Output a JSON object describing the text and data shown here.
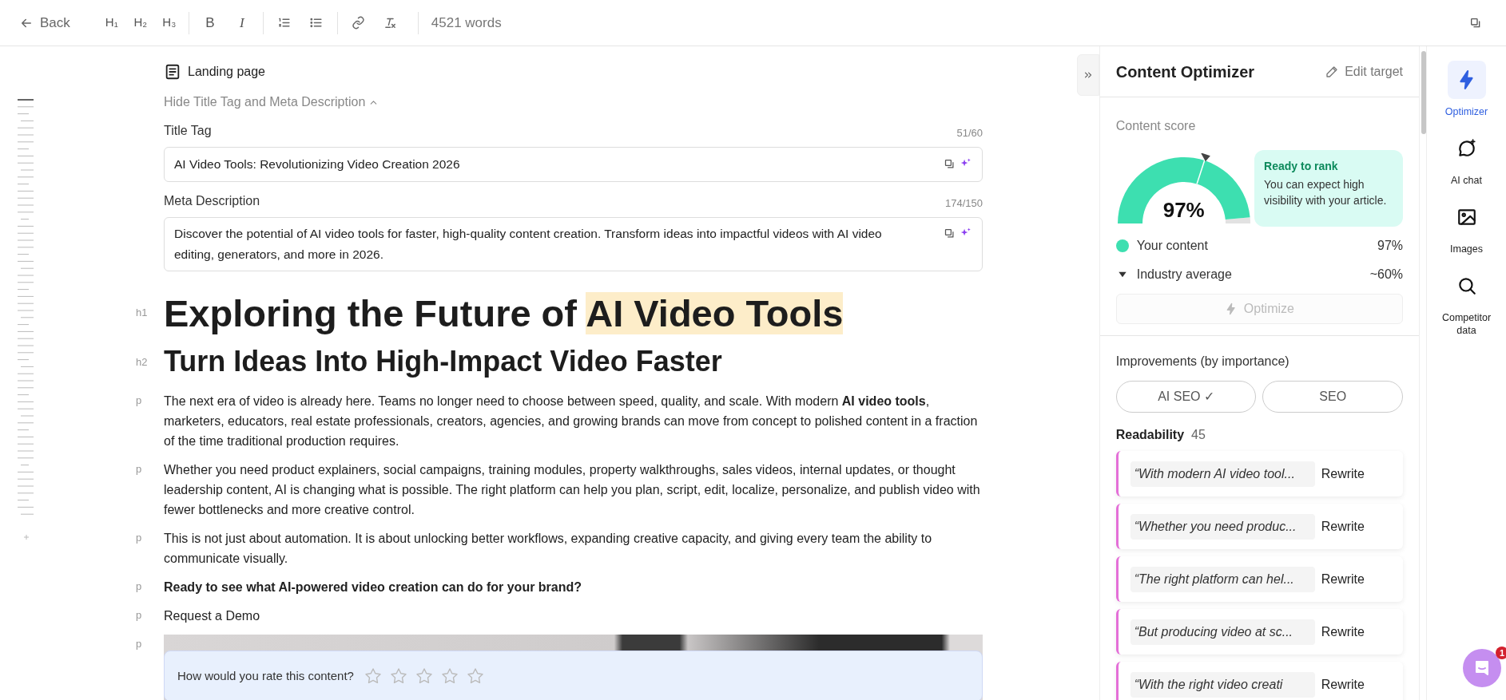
{
  "toolbar": {
    "back": "Back",
    "headings": [
      "H₁",
      "H₂",
      "H₃"
    ],
    "bold": "B",
    "italic": "I",
    "word_count": "4521 words"
  },
  "document": {
    "type_label": "Landing page",
    "toggle": "Hide Title Tag and Meta Description",
    "title_tag": {
      "label": "Title Tag",
      "count": "51/60",
      "value": "AI Video Tools: Revolutionizing Video Creation 2026"
    },
    "meta_description": {
      "label": "Meta Description",
      "count": "174/150",
      "value": "Discover the potential of AI video tools for faster, high-quality content creation. Transform ideas into impactful videos with AI video editing, generators, and more in 2026."
    },
    "blocks": [
      {
        "kind": "h1",
        "tag": "h1",
        "parts": [
          {
            "text": "Exploring the Future of ",
            "highlight": false
          },
          {
            "text": "AI Video Tools",
            "highlight": true
          }
        ]
      },
      {
        "kind": "h2",
        "tag": "h2",
        "parts": [
          {
            "text": "Turn Ideas Into High-Impact Video Faster",
            "highlight": false
          }
        ]
      },
      {
        "kind": "p",
        "tag": "p",
        "bold": false,
        "text": "The next era of video is already here. Teams no longer need to choose between speed, quality, and scale. With modern **AI video tools**, marketers, educators, real estate professionals, creators, agencies, and growing brands can move from concept to polished content in a fraction of the time traditional production requires."
      },
      {
        "kind": "p",
        "tag": "p",
        "bold": false,
        "text": "Whether you need product explainers, social campaigns, training modules, property walkthroughs, sales videos, internal updates, or thought leadership content, AI is changing what is possible. The right platform can help you plan, script, edit, localize, personalize, and publish video with fewer bottlenecks and more creative control."
      },
      {
        "kind": "p",
        "tag": "p",
        "bold": false,
        "text": "This is not just about automation. It is about unlocking better workflows, expanding creative capacity, and giving every team the ability to communicate visually."
      },
      {
        "kind": "p",
        "tag": "p",
        "bold": true,
        "text": "Ready to see what AI-powered video creation can do for your brand?"
      },
      {
        "kind": "p",
        "tag": "p",
        "bold": false,
        "text": "Request a Demo"
      },
      {
        "kind": "image",
        "tag": "p"
      }
    ],
    "rating": {
      "question": "How would you rate this content?",
      "stars": 0
    }
  },
  "optimizer": {
    "title": "Content Optimizer",
    "edit": "Edit target",
    "score_label": "Content score",
    "score": "97%",
    "level": 0.97,
    "tip": {
      "title": "Ready to rank",
      "text": "You can expect high visibility with your article."
    },
    "legend": [
      {
        "kind": "dot",
        "label": "Your content",
        "value": "97%",
        "color": "#3ddfb0"
      },
      {
        "kind": "marker",
        "label": "Industry average",
        "value": "~60%"
      }
    ],
    "optimize": {
      "label": "Optimize",
      "disabled": true
    },
    "improvements_label": "Improvements (by importance)",
    "filters": [
      "AI SEO ✓",
      "SEO"
    ],
    "section": {
      "title": "Readability",
      "count": "45"
    },
    "items": [
      {
        "quote": "“With modern AI video tool...",
        "action": "Rewrite"
      },
      {
        "quote": "“Whether you need produc...",
        "action": "Rewrite"
      },
      {
        "quote": "“The right platform can hel...",
        "action": "Rewrite"
      },
      {
        "quote": "“But producing video at sc...",
        "action": "Rewrite"
      },
      {
        "quote": "“With the right video creati",
        "action": "Rewrite"
      }
    ]
  },
  "rail": [
    {
      "kind": "bolt",
      "label": "Optimizer",
      "selected": true
    },
    {
      "kind": "chat",
      "label": "AI chat",
      "selected": false
    },
    {
      "kind": "image",
      "label": "Images",
      "selected": false
    },
    {
      "kind": "search",
      "label": "Competitor data",
      "selected": false
    }
  ],
  "chat_badge": "1"
}
